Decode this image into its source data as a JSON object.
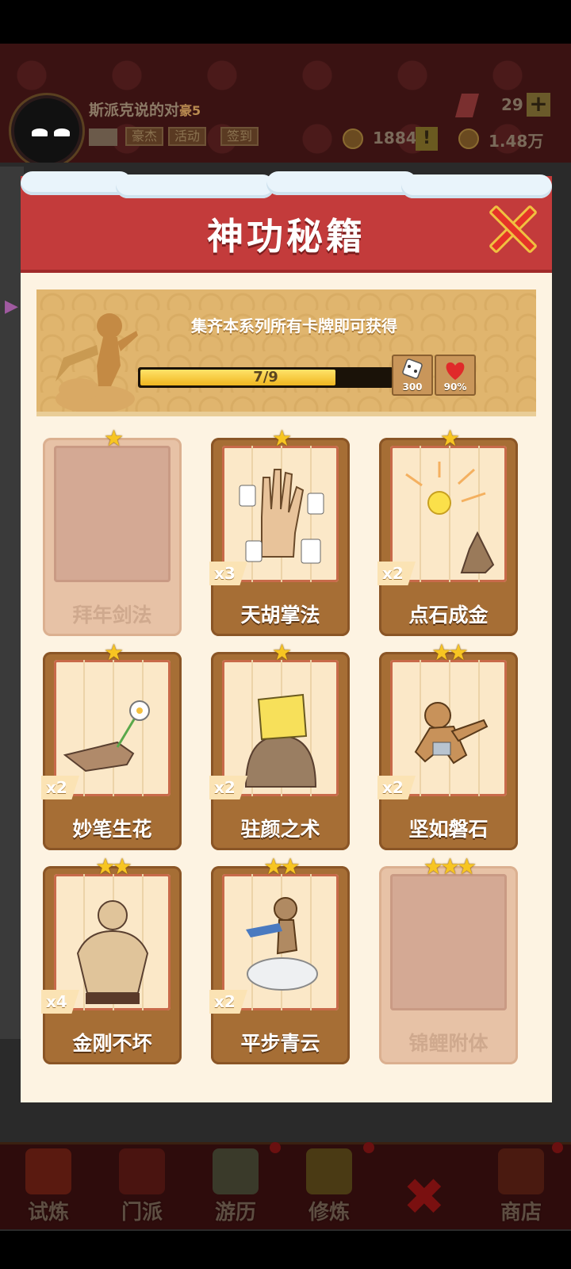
{
  "header": {
    "player_name": "斯派克说的对",
    "player_rank": "豪5",
    "buttons": [
      "豪杰",
      "活动",
      "签到"
    ],
    "gems": "29",
    "plus": "+",
    "tokens": "1884",
    "warning": "!",
    "coins": "1.48万"
  },
  "modal": {
    "title": "神功秘籍",
    "banner_text": "集齐本系列所有卡牌即可获得",
    "progress": {
      "text": "7/9",
      "fraction": 0.778
    },
    "rewards": [
      {
        "icon": "dice-icon",
        "value": "300"
      },
      {
        "icon": "heart-icon",
        "value": "90%"
      }
    ],
    "cards": [
      {
        "name": "拜年剑法",
        "stars": "★",
        "count": "",
        "locked": true
      },
      {
        "name": "天胡掌法",
        "stars": "★",
        "count": "x3",
        "locked": false
      },
      {
        "name": "点石成金",
        "stars": "★",
        "count": "x2",
        "locked": false
      },
      {
        "name": "妙笔生花",
        "stars": "★",
        "count": "x2",
        "locked": false
      },
      {
        "name": "驻颜之术",
        "stars": "★",
        "count": "x2",
        "locked": false
      },
      {
        "name": "坚如磐石",
        "stars": "★★",
        "count": "x2",
        "locked": false
      },
      {
        "name": "金刚不坏",
        "stars": "★★",
        "count": "x4",
        "locked": false
      },
      {
        "name": "平步青云",
        "stars": "★★",
        "count": "x2",
        "locked": false
      },
      {
        "name": "锦鲤附体",
        "stars": "★★★",
        "count": "",
        "locked": true
      }
    ]
  },
  "nav": {
    "items": [
      "试炼",
      "门派",
      "游历",
      "修炼",
      "商店"
    ]
  },
  "colors": {
    "modal_header": "#c33b3b",
    "modal_bg": "#fdf3e2",
    "card_frame": "#a66e35",
    "star": "#f7c522"
  }
}
